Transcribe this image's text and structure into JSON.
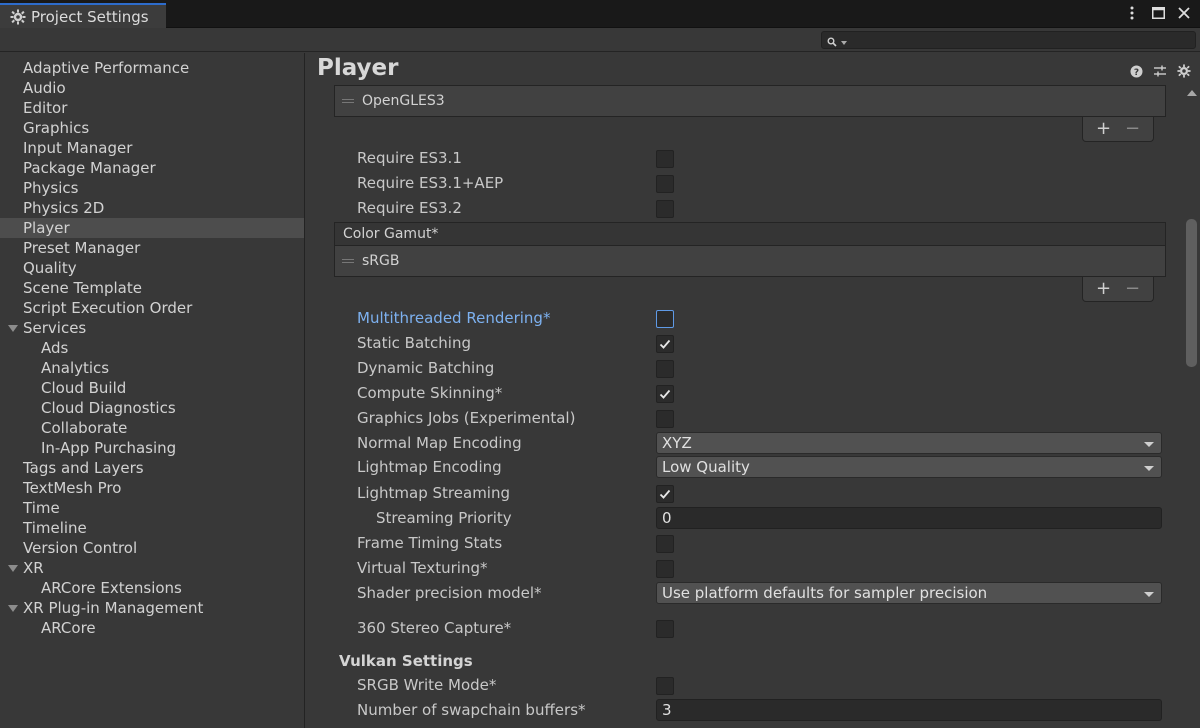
{
  "window": {
    "tab_title": "Project Settings",
    "icons": [
      "gear-icon",
      "kebab-menu-icon",
      "maximize-icon",
      "close-icon"
    ]
  },
  "search": {
    "value": "",
    "icon": "search-icon"
  },
  "sidebar": {
    "items": [
      {
        "label": "Adaptive Performance",
        "level": 0
      },
      {
        "label": "Audio",
        "level": 0
      },
      {
        "label": "Editor",
        "level": 0
      },
      {
        "label": "Graphics",
        "level": 0
      },
      {
        "label": "Input Manager",
        "level": 0
      },
      {
        "label": "Package Manager",
        "level": 0
      },
      {
        "label": "Physics",
        "level": 0
      },
      {
        "label": "Physics 2D",
        "level": 0
      },
      {
        "label": "Player",
        "level": 0,
        "selected": true
      },
      {
        "label": "Preset Manager",
        "level": 0
      },
      {
        "label": "Quality",
        "level": 0
      },
      {
        "label": "Scene Template",
        "level": 0
      },
      {
        "label": "Script Execution Order",
        "level": 0
      },
      {
        "label": "Services",
        "level": 0,
        "expandable": true
      },
      {
        "label": "Ads",
        "level": 1
      },
      {
        "label": "Analytics",
        "level": 1
      },
      {
        "label": "Cloud Build",
        "level": 1
      },
      {
        "label": "Cloud Diagnostics",
        "level": 1
      },
      {
        "label": "Collaborate",
        "level": 1
      },
      {
        "label": "In-App Purchasing",
        "level": 1
      },
      {
        "label": "Tags and Layers",
        "level": 0
      },
      {
        "label": "TextMesh Pro",
        "level": 0
      },
      {
        "label": "Time",
        "level": 0
      },
      {
        "label": "Timeline",
        "level": 0
      },
      {
        "label": "Version Control",
        "level": 0
      },
      {
        "label": "XR",
        "level": 0,
        "expandable": true
      },
      {
        "label": "ARCore Extensions",
        "level": 1
      },
      {
        "label": "XR Plug-in Management",
        "level": 0,
        "expandable": true
      },
      {
        "label": "ARCore",
        "level": 1
      }
    ]
  },
  "main": {
    "title": "Player",
    "header_icons": [
      "help-icon",
      "presets-icon",
      "settings-icon"
    ],
    "graphics_api_list": {
      "items": [
        "OpenGLES3"
      ],
      "add": "+",
      "remove": "−"
    },
    "es_options": [
      {
        "label": "Require ES3.1",
        "checked": false
      },
      {
        "label": "Require ES3.1+AEP",
        "checked": false
      },
      {
        "label": "Require ES3.2",
        "checked": false
      }
    ],
    "color_gamut": {
      "header": "Color Gamut*",
      "items": [
        "sRGB"
      ],
      "add": "+",
      "remove": "−"
    },
    "settings": [
      {
        "label": "Multithreaded Rendering*",
        "type": "checkbox",
        "checked": false,
        "focused": true
      },
      {
        "label": "Static Batching",
        "type": "checkbox",
        "checked": true
      },
      {
        "label": "Dynamic Batching",
        "type": "checkbox",
        "checked": false
      },
      {
        "label": "Compute Skinning*",
        "type": "checkbox",
        "checked": true
      },
      {
        "label": "Graphics Jobs (Experimental)",
        "type": "checkbox",
        "checked": false
      },
      {
        "label": "Normal Map Encoding",
        "type": "dropdown",
        "value": "XYZ"
      },
      {
        "label": "Lightmap Encoding",
        "type": "dropdown",
        "value": "Low Quality"
      },
      {
        "label": "Lightmap Streaming",
        "type": "checkbox",
        "checked": true
      },
      {
        "label": "Streaming Priority",
        "type": "text",
        "value": "0",
        "indent": true
      },
      {
        "label": "Frame Timing Stats",
        "type": "checkbox",
        "checked": false
      },
      {
        "label": "Virtual Texturing*",
        "type": "checkbox",
        "checked": false
      },
      {
        "label": "Shader precision model*",
        "type": "dropdown",
        "value": "Use platform defaults for sampler precision"
      },
      {
        "label": "360 Stereo Capture*",
        "type": "checkbox",
        "checked": false
      }
    ],
    "vulkan": {
      "heading": "Vulkan Settings",
      "settings": [
        {
          "label": "SRGB Write Mode*",
          "type": "checkbox",
          "checked": false
        },
        {
          "label": "Number of swapchain buffers*",
          "type": "text",
          "value": "3"
        }
      ]
    }
  }
}
